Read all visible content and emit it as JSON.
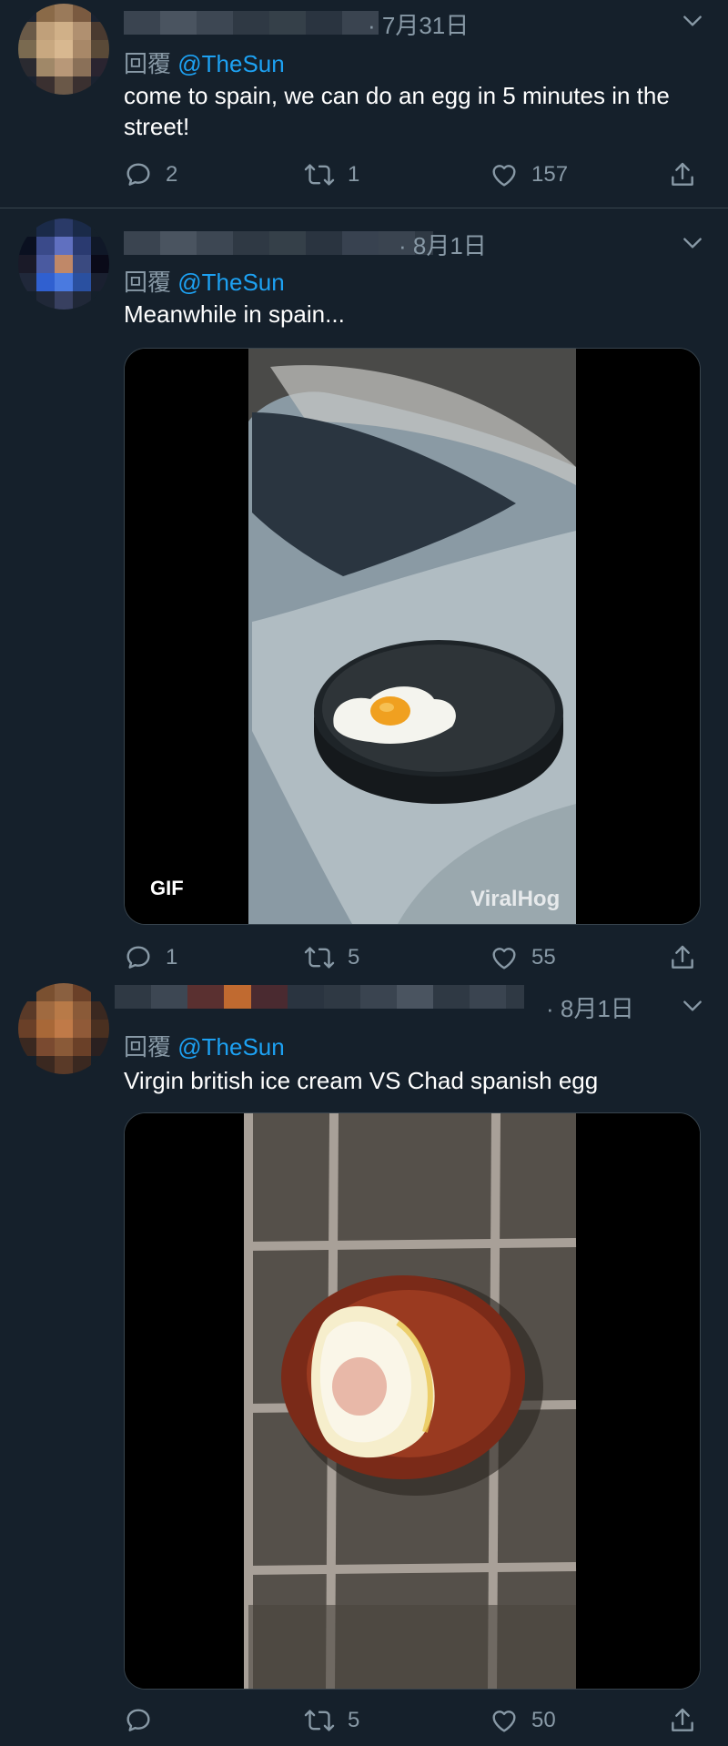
{
  "tweets": [
    {
      "date": "· 7月31日",
      "reply_prefix": "回覆",
      "reply_handle": "@TheSun",
      "text": "come to spain, we can do an egg in 5 minutes in the street!",
      "replies": "2",
      "retweets": "1",
      "likes": "157",
      "avatar_colors": [
        "#1a2230",
        "#8a6a48",
        "#9a7a5a",
        "#7a5a40",
        "#1a2230",
        "#6a5a48",
        "#c0a07a",
        "#d0b088",
        "#b09070",
        "#4a3a30",
        "#7a6a50",
        "#c8a880",
        "#d8b890",
        "#a88868",
        "#5a4a38",
        "#2a2a30",
        "#a08868",
        "#b89878",
        "#8a7058",
        "#2a2430",
        "#1a2230",
        "#3a3030",
        "#6a5848",
        "#3a3030",
        "#1a2230"
      ]
    },
    {
      "date": "· 8月1日",
      "reply_prefix": "回覆",
      "reply_handle": "@TheSun",
      "text": "Meanwhile in spain...",
      "gif_label": "GIF",
      "watermark": "ViralHog",
      "replies": "1",
      "retweets": "5",
      "likes": "55",
      "avatar_colors": [
        "#15202b",
        "#1a2a48",
        "#2a3a68",
        "#1a2a48",
        "#15202b",
        "#0a1020",
        "#3a4a8a",
        "#6070c0",
        "#2a3a70",
        "#101828",
        "#1a1a28",
        "#4a5aa0",
        "#c08868",
        "#3a4a80",
        "#0a0a18",
        "#20283a",
        "#3060d0",
        "#4a7ae0",
        "#2a50a0",
        "#1a2030",
        "#15202b",
        "#202838",
        "#384060",
        "#202838",
        "#15202b"
      ]
    },
    {
      "date": "· 8月1日",
      "reply_prefix": "回覆",
      "reply_handle": "@TheSun",
      "text": "Virgin british ice cream VS Chad spanish egg",
      "replies": "",
      "retweets": "5",
      "likes": "50",
      "avatar_colors": [
        "#15202b",
        "#7a5030",
        "#8a6040",
        "#6a4028",
        "#15202b",
        "#5a3a28",
        "#a06a40",
        "#b87a48",
        "#8a5a38",
        "#3a2820",
        "#6a4028",
        "#a86838",
        "#c07a48",
        "#905a38",
        "#4a3020",
        "#3a2820",
        "#7a4a30",
        "#8a5a38",
        "#6a4028",
        "#2a2020",
        "#15202b",
        "#3a2820",
        "#5a3a28",
        "#3a2820",
        "#15202b"
      ]
    }
  ],
  "colors": {
    "background": "#15202b",
    "text_secondary": "#8899a6",
    "link": "#1da1f2",
    "divider": "#38444d"
  }
}
